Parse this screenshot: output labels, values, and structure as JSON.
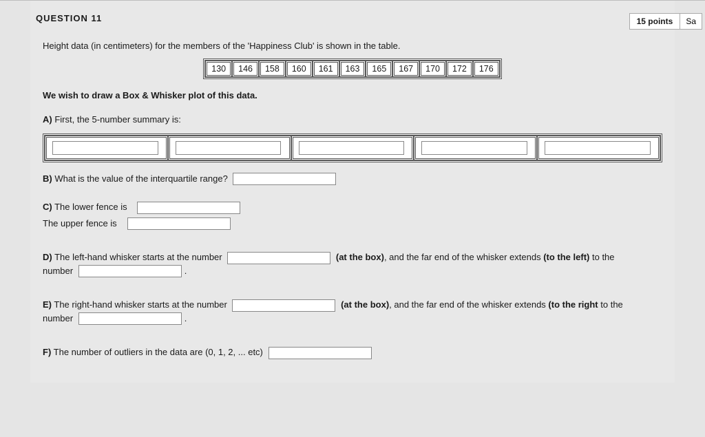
{
  "header": {
    "question_label": "QUESTION 11",
    "points_label": "15 points",
    "save_label": "Sa"
  },
  "intro": "Height data (in centimeters) for the members of the 'Happiness Club' is shown in the table.",
  "data_values": [
    "130",
    "146",
    "158",
    "160",
    "161",
    "163",
    "165",
    "167",
    "170",
    "172",
    "176"
  ],
  "wish_line": "We wish to draw a Box & Whisker plot of this data.",
  "a": {
    "label": "A)",
    "text": "First, the 5-number summary is:"
  },
  "b": {
    "label": "B)",
    "text": "What is the value of the interquartile range?"
  },
  "c": {
    "label": "C)",
    "lower_text": "The lower fence is",
    "upper_text": "The upper fence is"
  },
  "d": {
    "label": "D)",
    "pre": "The left-hand whisker starts at the number",
    "mid_bold": "(at the box)",
    "mid_rest": ", and the far end of the whisker extends",
    "to_bold": "(to the left)",
    "to_rest": "to the number",
    "end": "."
  },
  "e": {
    "label": "E)",
    "pre": "The right-hand whisker starts at the number",
    "mid_bold": "(at the box)",
    "mid_rest": ", and the far end of the whisker extends",
    "to_bold": "(to the right",
    "to_rest": "to the number",
    "end": "."
  },
  "f": {
    "label": "F)",
    "text": "The number of outliers in the data are (0, 1, 2, ... etc)"
  }
}
